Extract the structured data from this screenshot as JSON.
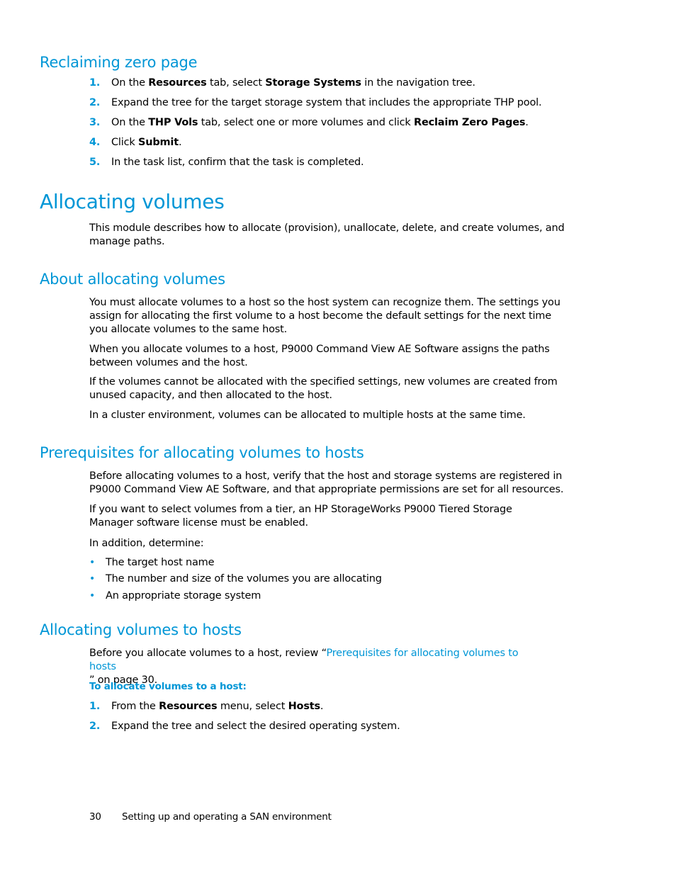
{
  "sections": {
    "reclaiming": {
      "title": "Reclaiming zero page",
      "steps": [
        {
          "num": "1.",
          "t1": "On the ",
          "b1": "Resources",
          "t2": " tab, select ",
          "b2": "Storage Systems",
          "t3": " in the navigation tree."
        },
        {
          "num": "2.",
          "t1": "Expand the tree for the target storage system that includes the appropriate THP pool."
        },
        {
          "num": "3.",
          "t1": "On the ",
          "b1": "THP Vols",
          "t2": " tab, select one or more volumes and click ",
          "b2": "Reclaim Zero Pages",
          "t3": "."
        },
        {
          "num": "4.",
          "t1": "Click ",
          "b1": "Submit",
          "t2": "."
        },
        {
          "num": "5.",
          "t1": "In the task list, confirm that the task is completed."
        }
      ]
    },
    "allocating": {
      "title": "Allocating volumes",
      "intro": "This module describes how to allocate (provision), unallocate, delete, and create volumes, and manage paths."
    },
    "about": {
      "title": "About allocating volumes",
      "paragraphs": [
        "You must allocate volumes to a host so the host system can recognize them. The settings you assign for allocating the first volume to a host become the default settings for the next time you allocate volumes to the same host.",
        "When you allocate volumes to a host, P9000 Command View AE Software assigns the paths between volumes and the host.",
        "If the volumes cannot be allocated with the specified settings, new volumes are created from unused capacity, and then allocated to the host.",
        "In a cluster environment, volumes can be allocated to multiple hosts at the same time."
      ]
    },
    "prereq": {
      "title": "Prerequisites for allocating volumes to hosts",
      "paragraphs": [
        "Before allocating volumes to a host, verify that the host and storage systems are registered in P9000 Command View AE Software, and that appropriate permissions are set for all resources.",
        "If you want to select volumes from a tier, an HP StorageWorks P9000 Tiered Storage Manager software license must be enabled.",
        "In addition, determine:"
      ],
      "bullets": [
        "The target host name",
        "The number and size of the volumes you are allocating",
        "An appropriate storage system"
      ]
    },
    "hosts": {
      "title": "Allocating volumes to hosts",
      "review_before": "Before you allocate volumes to a host, review “",
      "review_link": "Prerequisites for allocating volumes to hosts",
      "review_after": "” on page 30.",
      "procedure_title": "To allocate volumes to a host:",
      "steps": [
        {
          "num": "1.",
          "t1": "From the ",
          "b1": "Resources",
          "t2": " menu, select ",
          "b2": "Hosts",
          "t3": "."
        },
        {
          "num": "2.",
          "t1": "Expand the tree and select the desired operating system."
        }
      ]
    }
  },
  "footer": {
    "page_number": "30",
    "chapter": "Setting up and operating a SAN environment"
  },
  "colors": {
    "accent": "#0096d6",
    "text": "#000000"
  }
}
